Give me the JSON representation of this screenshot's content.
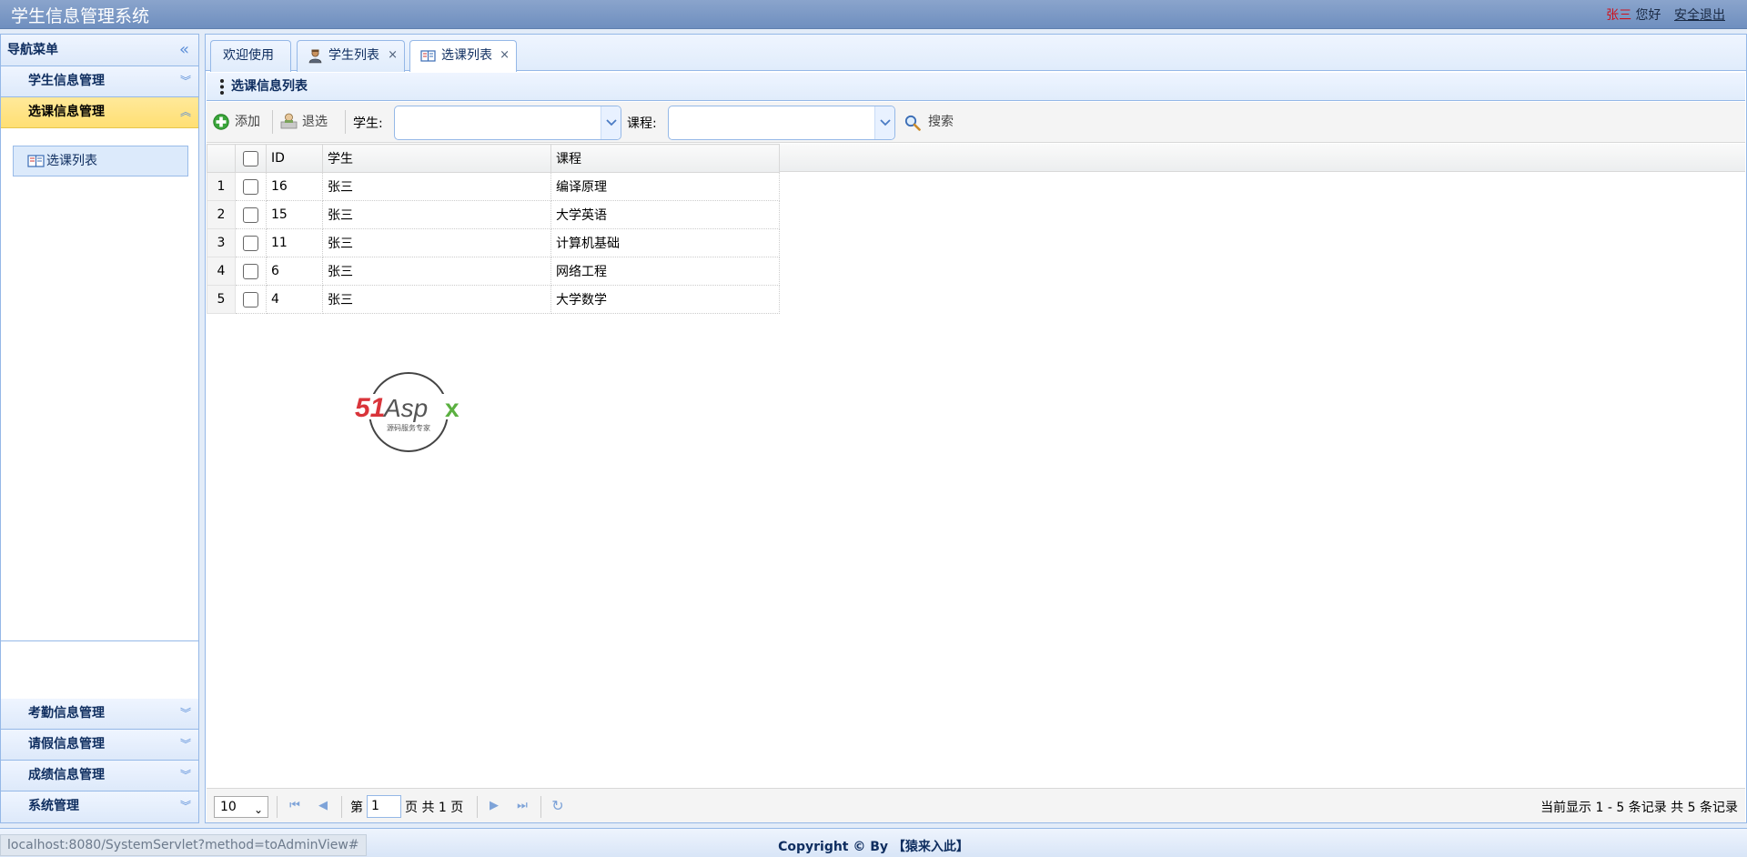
{
  "header": {
    "title": "学生信息管理系统",
    "user_name": "张三",
    "greeting": "您好",
    "logout": "安全退出"
  },
  "sidebar": {
    "title": "导航菜单",
    "sections": [
      {
        "label": "学生信息管理"
      },
      {
        "label": "选课信息管理"
      },
      {
        "label": "考勤信息管理"
      },
      {
        "label": "请假信息管理"
      },
      {
        "label": "成绩信息管理"
      },
      {
        "label": "系统管理"
      }
    ],
    "active_item": "选课列表"
  },
  "tabs": [
    {
      "label": "欢迎使用",
      "closable": false
    },
    {
      "label": "学生列表",
      "closable": true
    },
    {
      "label": "选课列表",
      "closable": true
    }
  ],
  "tab_close_glyph": "×",
  "panel": {
    "title": "选课信息列表"
  },
  "toolbar": {
    "add": "添加",
    "withdraw": "退选",
    "student_label": "学生:",
    "course_label": "课程:",
    "search": "搜索"
  },
  "grid": {
    "columns": [
      "ID",
      "学生",
      "课程"
    ],
    "rows": [
      {
        "num": "1",
        "id": "16",
        "student": "张三",
        "course": "编译原理"
      },
      {
        "num": "2",
        "id": "15",
        "student": "张三",
        "course": "大学英语"
      },
      {
        "num": "3",
        "id": "11",
        "student": "张三",
        "course": "计算机基础"
      },
      {
        "num": "4",
        "id": "6",
        "student": "张三",
        "course": "网络工程"
      },
      {
        "num": "5",
        "id": "4",
        "student": "张三",
        "course": "大学数学"
      }
    ]
  },
  "watermark": {
    "brand": "51Aspx",
    "tagline": "源码服务专家"
  },
  "pager": {
    "page_size": "10",
    "page_prefix": "第",
    "current_page": "1",
    "page_suffix": "页 共 1 页",
    "info": "当前显示 1 - 5 条记录 共 5 条记录"
  },
  "footer": {
    "status_url": "localhost:8080/SystemServlet?method=toAdminView#",
    "copyright": "Copyright © By 【猿来入此】"
  },
  "colors": {
    "header_bg": "#7793c3",
    "border": "#95b8e7",
    "selected_section": "#ffe48d",
    "link_red": "#d0101a"
  }
}
